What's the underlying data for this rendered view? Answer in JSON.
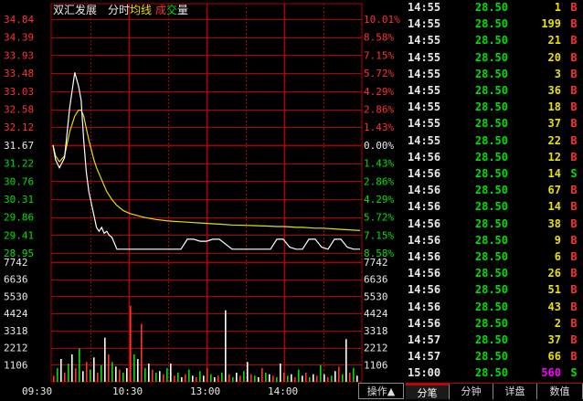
{
  "header": {
    "name": "双汇发展",
    "mode": "分时",
    "legend_avg": "均线",
    "legend_vol_a": "成",
    "legend_vol_b": "交",
    "legend_vol_c": "量"
  },
  "colors": {
    "grid": "#b00000",
    "up": "#ff3030",
    "down": "#00e000",
    "neutral": "#e8e8e8",
    "price_line": "#ffffff",
    "avg_line": "#e8e000",
    "vol_sell": "#ff3030",
    "vol_buy": "#00e000",
    "vol_neutral": "#ffffff",
    "highlight": "#ff00ff"
  },
  "chart_data": {
    "type": "line",
    "title": "双汇发展",
    "price_ticks_left": [
      "34.84",
      "34.39",
      "33.93",
      "33.48",
      "33.03",
      "32.58",
      "32.12",
      "31.67",
      "31.22",
      "30.76",
      "30.31",
      "29.86",
      "29.41",
      "28.95"
    ],
    "pct_ticks_right": [
      "10.01%",
      "8.58%",
      "7.15%",
      "5.72%",
      "4.29%",
      "2.86%",
      "1.43%",
      "0.00%",
      "1.43%",
      "2.86%",
      "4.29%",
      "5.72%",
      "7.15%",
      "8.58%"
    ],
    "prev_close": 31.67,
    "ylim": [
      28.95,
      34.84
    ],
    "volume_ticks_left": [
      "7742",
      "6636",
      "5530",
      "4424",
      "3318",
      "2212",
      "1106"
    ],
    "volume_ticks_right": [
      "7742",
      "6636",
      "5530",
      "4424",
      "3318",
      "2212",
      "1106"
    ],
    "x_ticks": [
      "09:30",
      "10:30",
      "13:00",
      "14:00"
    ],
    "x": [
      0,
      2,
      5,
      9,
      13,
      17,
      20,
      22,
      24,
      26,
      28,
      30,
      32,
      34,
      36,
      38,
      40,
      42,
      44,
      46,
      50,
      55,
      60,
      70,
      80,
      90,
      100,
      105,
      110,
      115,
      120,
      125,
      130,
      140,
      150,
      160,
      170,
      175,
      180,
      185,
      190,
      195,
      200,
      205,
      210,
      215,
      220,
      225,
      230,
      235,
      240
    ],
    "series": [
      {
        "values": [
          31.67,
          31.3,
          31.1,
          31.35,
          32.6,
          33.5,
          33.15,
          32.8,
          31.8,
          31.0,
          30.5,
          30.2,
          29.9,
          29.6,
          29.5,
          29.6,
          29.45,
          29.5,
          29.4,
          29.35,
          29.05,
          29.05,
          29.05,
          29.05,
          29.05,
          29.05,
          29.05,
          29.3,
          29.3,
          29.25,
          29.25,
          29.3,
          29.3,
          29.05,
          29.05,
          29.05,
          29.05,
          29.3,
          29.3,
          29.1,
          29.05,
          29.05,
          29.3,
          29.3,
          29.1,
          29.05,
          29.3,
          29.3,
          29.1,
          29.05,
          29.05
        ]
      },
      {
        "values": [
          31.67,
          31.4,
          31.25,
          31.4,
          32.0,
          32.4,
          32.55,
          32.55,
          32.4,
          32.1,
          31.8,
          31.55,
          31.3,
          31.1,
          30.95,
          30.8,
          30.65,
          30.5,
          30.4,
          30.3,
          30.15,
          30.02,
          29.95,
          29.86,
          29.8,
          29.76,
          29.74,
          29.73,
          29.72,
          29.71,
          29.7,
          29.69,
          29.68,
          29.66,
          29.65,
          29.64,
          29.63,
          29.62,
          29.62,
          29.61,
          29.6,
          29.6,
          29.59,
          29.58,
          29.58,
          29.57,
          29.56,
          29.55,
          29.54,
          29.53,
          29.52
        ]
      }
    ],
    "volume": {
      "ylim": [
        0,
        7742
      ],
      "values": [
        400,
        900,
        1500,
        600,
        1200,
        1800,
        900,
        2200,
        700,
        1300,
        800,
        1600,
        600,
        1100,
        2900,
        1800,
        1300,
        1000,
        800,
        600,
        900,
        5000,
        1800,
        1500,
        3800,
        900,
        1200,
        800,
        600,
        700,
        500,
        900,
        1200,
        400,
        600,
        300,
        500,
        800,
        400,
        300,
        700,
        400,
        900,
        500,
        300,
        400,
        600,
        4700,
        500,
        300,
        600,
        400,
        700,
        1300,
        500,
        400,
        300,
        900,
        600,
        500,
        400,
        300,
        1200,
        600,
        400,
        500,
        300,
        800,
        400,
        600,
        300,
        500,
        400,
        1100,
        500,
        300,
        400,
        700,
        1000,
        500,
        2800,
        600,
        900,
        400
      ]
    }
  },
  "ticks": [
    {
      "time": "14:55",
      "price": "28.50",
      "vol": "1",
      "side": "B"
    },
    {
      "time": "14:55",
      "price": "28.50",
      "vol": "199",
      "side": "B"
    },
    {
      "time": "14:55",
      "price": "28.50",
      "vol": "21",
      "side": "B"
    },
    {
      "time": "14:55",
      "price": "28.50",
      "vol": "20",
      "side": "B"
    },
    {
      "time": "14:55",
      "price": "28.50",
      "vol": "3",
      "side": "B"
    },
    {
      "time": "14:55",
      "price": "28.50",
      "vol": "36",
      "side": "B"
    },
    {
      "time": "14:55",
      "price": "28.50",
      "vol": "18",
      "side": "B"
    },
    {
      "time": "14:55",
      "price": "28.50",
      "vol": "37",
      "side": "B"
    },
    {
      "time": "14:55",
      "price": "28.50",
      "vol": "22",
      "side": "B"
    },
    {
      "time": "14:56",
      "price": "28.50",
      "vol": "12",
      "side": "B"
    },
    {
      "time": "14:56",
      "price": "28.50",
      "vol": "14",
      "side": "S"
    },
    {
      "time": "14:56",
      "price": "28.50",
      "vol": "67",
      "side": "B"
    },
    {
      "time": "14:56",
      "price": "28.50",
      "vol": "14",
      "side": "B"
    },
    {
      "time": "14:56",
      "price": "28.50",
      "vol": "38",
      "side": "B"
    },
    {
      "time": "14:56",
      "price": "28.50",
      "vol": "9",
      "side": "B"
    },
    {
      "time": "14:56",
      "price": "28.50",
      "vol": "6",
      "side": "B"
    },
    {
      "time": "14:56",
      "price": "28.50",
      "vol": "26",
      "side": "B"
    },
    {
      "time": "14:56",
      "price": "28.50",
      "vol": "51",
      "side": "B"
    },
    {
      "time": "14:56",
      "price": "28.50",
      "vol": "43",
      "side": "B"
    },
    {
      "time": "14:56",
      "price": "28.50",
      "vol": "2",
      "side": "B"
    },
    {
      "time": "14:57",
      "price": "28.50",
      "vol": "37",
      "side": "B"
    },
    {
      "time": "14:57",
      "price": "28.50",
      "vol": "66",
      "side": "B"
    },
    {
      "time": "15:00",
      "price": "28.50",
      "vol": "560",
      "side": "S",
      "highlight": true
    }
  ],
  "footer": {
    "ops_label": "操作",
    "ops_arrow": "▲",
    "tabs": [
      "分笔",
      "分钟",
      "详盘",
      "数值"
    ],
    "active_tab": 0
  }
}
